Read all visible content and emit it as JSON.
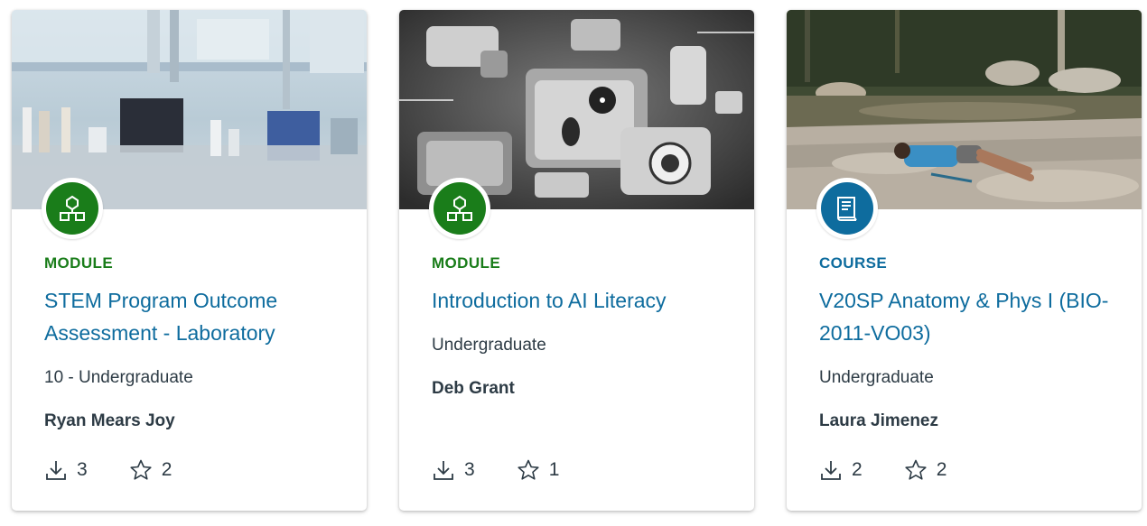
{
  "colors": {
    "module": "#1a7d1a",
    "course": "#0e6c9e",
    "title": "#0e6c9e",
    "text": "#2d3b45"
  },
  "cards": [
    {
      "type": "MODULE",
      "type_icon": "module-hierarchy-icon",
      "title": "STEM Program Outcome Assessment - Laboratory",
      "level": "10 - Undergraduate",
      "author": "Ryan Mears Joy",
      "downloads": "3",
      "favorites": "2",
      "image": "laboratory-equipment-photo"
    },
    {
      "type": "MODULE",
      "type_icon": "module-hierarchy-icon",
      "title": "Introduction to AI Literacy",
      "level": "Undergraduate",
      "author": "Deb Grant",
      "downloads": "3",
      "favorites": "1",
      "image": "ai-symbols-monochrome-photo"
    },
    {
      "type": "COURSE",
      "type_icon": "book-icon",
      "title": "V20SP Anatomy & Phys I (BIO-2011-VO03)",
      "level": "Undergraduate",
      "author": "Laura Jimenez",
      "downloads": "2",
      "favorites": "2",
      "image": "person-resting-by-river-photo"
    }
  ]
}
